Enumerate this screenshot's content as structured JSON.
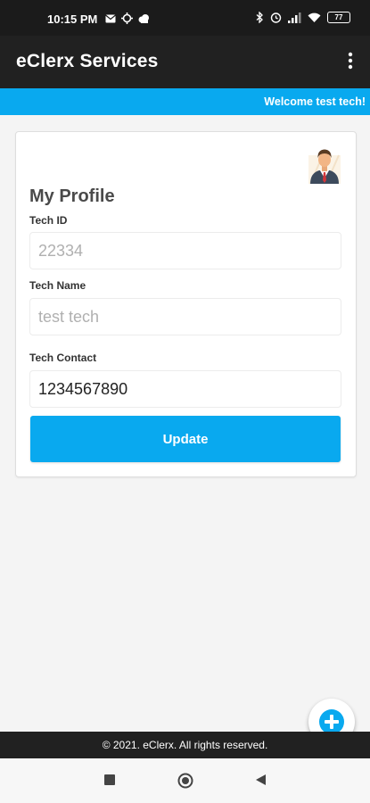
{
  "status_bar": {
    "time": "10:15 PM",
    "battery": "77",
    "left_icons": [
      "message-icon",
      "crosshair-icon",
      "cloud-icon"
    ],
    "right_icons": [
      "bluetooth-icon",
      "alarm-icon",
      "signal-icon",
      "wifi-icon",
      "battery-icon"
    ]
  },
  "app_bar": {
    "title": "eClerx Services",
    "menu_icon": "more-vertical-icon"
  },
  "banner": {
    "welcome": "Welcome test tech!"
  },
  "profile": {
    "title": "My Profile",
    "fields": [
      {
        "label": "Tech ID",
        "value": "",
        "placeholder": "22334"
      },
      {
        "label": "Tech Name",
        "value": "",
        "placeholder": "test tech"
      },
      {
        "label": "Tech Contact",
        "value": "1234567890",
        "placeholder": ""
      }
    ],
    "update_label": "Update"
  },
  "fab": {
    "icon": "plus-circle-icon"
  },
  "footer": {
    "copyright": "© 2021. eClerx. All rights reserved."
  },
  "nav": {
    "icons": [
      "recents-square-icon",
      "home-circle-icon",
      "back-triangle-icon"
    ]
  },
  "colors": {
    "accent": "#09a9ef",
    "app_bar": "#212121",
    "status_bar": "#1b1b1b",
    "background": "#f4f4f4"
  }
}
